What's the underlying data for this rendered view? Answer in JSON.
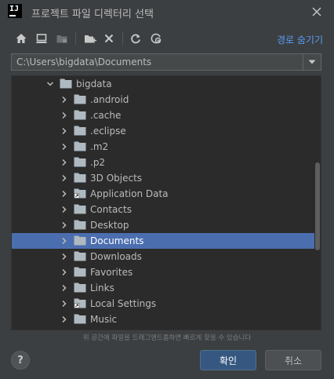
{
  "window": {
    "logo_text": "IJ",
    "title": "프로젝트 파일 디렉터리 선택"
  },
  "toolbar": {
    "hide_path_label": "경로 숨기기"
  },
  "path": {
    "value": "C:\\Users\\bigdata\\Documents"
  },
  "tree": {
    "items": [
      {
        "label": "bigdata",
        "level": 0,
        "expanded": true,
        "selected": false,
        "shortcut": false
      },
      {
        "label": ".android",
        "level": 1,
        "expanded": false,
        "selected": false,
        "shortcut": false
      },
      {
        "label": ".cache",
        "level": 1,
        "expanded": false,
        "selected": false,
        "shortcut": false
      },
      {
        "label": ".eclipse",
        "level": 1,
        "expanded": false,
        "selected": false,
        "shortcut": false
      },
      {
        "label": ".m2",
        "level": 1,
        "expanded": false,
        "selected": false,
        "shortcut": false
      },
      {
        "label": ".p2",
        "level": 1,
        "expanded": false,
        "selected": false,
        "shortcut": false
      },
      {
        "label": "3D Objects",
        "level": 1,
        "expanded": false,
        "selected": false,
        "shortcut": false
      },
      {
        "label": "Application Data",
        "level": 1,
        "expanded": false,
        "selected": false,
        "shortcut": true
      },
      {
        "label": "Contacts",
        "level": 1,
        "expanded": false,
        "selected": false,
        "shortcut": false
      },
      {
        "label": "Desktop",
        "level": 1,
        "expanded": false,
        "selected": false,
        "shortcut": false
      },
      {
        "label": "Documents",
        "level": 1,
        "expanded": false,
        "selected": true,
        "shortcut": false
      },
      {
        "label": "Downloads",
        "level": 1,
        "expanded": false,
        "selected": false,
        "shortcut": false
      },
      {
        "label": "Favorites",
        "level": 1,
        "expanded": false,
        "selected": false,
        "shortcut": false
      },
      {
        "label": "Links",
        "level": 1,
        "expanded": false,
        "selected": false,
        "shortcut": false
      },
      {
        "label": "Local Settings",
        "level": 1,
        "expanded": false,
        "selected": false,
        "shortcut": true
      },
      {
        "label": "Music",
        "level": 1,
        "expanded": false,
        "selected": false,
        "shortcut": false
      },
      {
        "label": "",
        "level": 1,
        "expanded": false,
        "selected": false,
        "shortcut": true
      }
    ]
  },
  "hint": "위 공간에 파일을 드래그앤드롭하면 빠르게 찾을 수 있습니다",
  "buttons": {
    "help": "?",
    "ok": "확인",
    "cancel": "취소"
  },
  "colors": {
    "background": "#3c3f41",
    "tree_background": "#2b2b2b",
    "selection": "#4b6eaf",
    "link": "#589df6",
    "primary_button": "#365880",
    "folder": "#aeb9c0"
  },
  "icons": {
    "app": "intellij-logo-icon",
    "close": "close-icon",
    "home": "home-icon",
    "desktop": "desktop-icon",
    "project": "project-folder-icon",
    "new_folder": "new-folder-icon",
    "delete": "delete-icon",
    "refresh": "refresh-icon",
    "show_hidden": "show-hidden-icon",
    "dropdown": "chevron-down-icon",
    "folder": "folder-icon",
    "expand": "chevron-right-icon"
  }
}
